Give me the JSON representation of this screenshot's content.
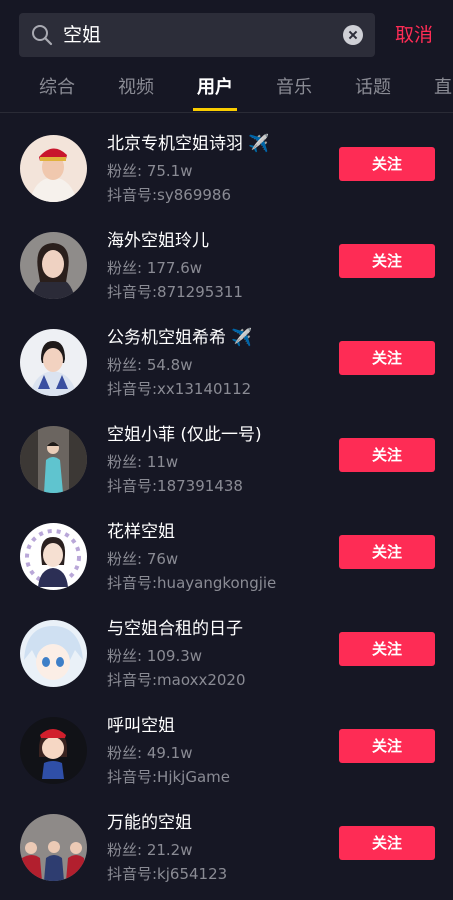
{
  "search": {
    "query": "空姐",
    "cancel_label": "取消"
  },
  "tabs": [
    {
      "label": "综合"
    },
    {
      "label": "视频"
    },
    {
      "label": "用户"
    },
    {
      "label": "音乐"
    },
    {
      "label": "话题"
    },
    {
      "label": "直"
    }
  ],
  "active_tab": "用户",
  "accent_color": "#fe2c55",
  "tab_indicator_color": "#facd00",
  "users": [
    {
      "name": "北京专机空姐诗羽 ✈️",
      "fans": "粉丝: 75.1w",
      "douyin_id": "抖音号:sy869986",
      "follow_label": "关注"
    },
    {
      "name": "海外空姐玲儿",
      "fans": "粉丝: 177.6w",
      "douyin_id": "抖音号:871295311",
      "follow_label": "关注"
    },
    {
      "name": "公务机空姐希希 ✈️",
      "fans": "粉丝: 54.8w",
      "douyin_id": "抖音号:xx13140112",
      "follow_label": "关注"
    },
    {
      "name": "空姐小菲 (仅此一号)",
      "fans": "粉丝: 11w",
      "douyin_id": "抖音号:187391438",
      "follow_label": "关注"
    },
    {
      "name": "花样空姐",
      "fans": "粉丝: 76w",
      "douyin_id": "抖音号:huayangkongjie",
      "follow_label": "关注"
    },
    {
      "name": "与空姐合租的日子",
      "fans": "粉丝: 109.3w",
      "douyin_id": "抖音号:maoxx2020",
      "follow_label": "关注"
    },
    {
      "name": "呼叫空姐",
      "fans": "粉丝: 49.1w",
      "douyin_id": "抖音号:HjkjGame",
      "follow_label": "关注"
    },
    {
      "name": "万能的空姐",
      "fans": "粉丝: 21.2w",
      "douyin_id": "抖音号:kj654123",
      "follow_label": "关注"
    }
  ]
}
